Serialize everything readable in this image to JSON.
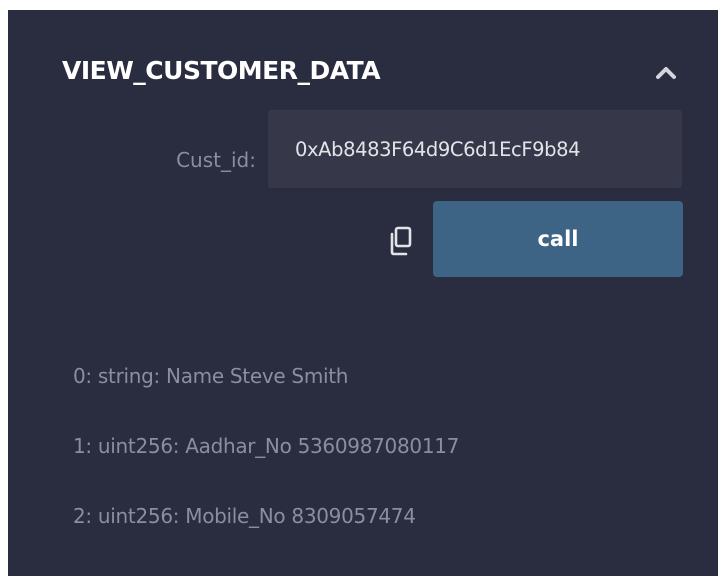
{
  "function": {
    "title": "VIEW_CUSTOMER_DATA",
    "collapse_icon": "chevron-up-icon"
  },
  "params": {
    "cust_id_label": "Cust_id:",
    "cust_id_value": "0xAb8483F64d9C6d1EcF9b84"
  },
  "actions": {
    "copy_icon": "copy-icon",
    "call_label": "call"
  },
  "results": [
    "0: string: Name Steve Smith",
    "1: uint256: Aadhar_No 5360987080117",
    "2: uint256: Mobile_No 8309057474"
  ],
  "colors": {
    "panel_bg": "#2a2c3f",
    "input_bg": "#363849",
    "button_bg": "#3d6485",
    "muted_text": "#8b8e9e",
    "title_text": "#ffffff"
  }
}
